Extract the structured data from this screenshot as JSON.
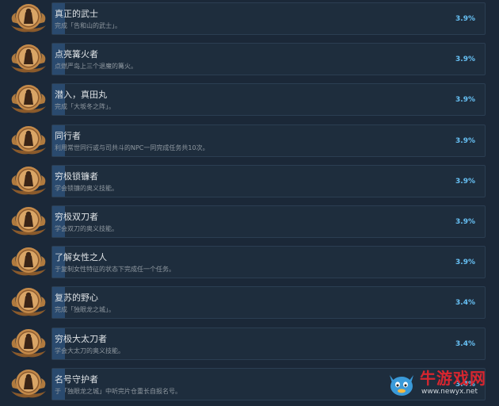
{
  "achievements": [
    {
      "title": "真正的武士",
      "desc": "完成「告和山的武士」。",
      "pct": "3.9%",
      "icon": "samurai-medal-icon"
    },
    {
      "title": "点亮篝火者",
      "desc": "点燃严岛上三个退魔的篝火。",
      "pct": "3.9%",
      "icon": "bonfire-medal-icon"
    },
    {
      "title": "潜入，真田丸",
      "desc": "完成「大坂冬之阵」。",
      "pct": "3.9%",
      "icon": "infiltrator-medal-icon"
    },
    {
      "title": "同行者",
      "desc": "利用常世同行或与司共斗的NPC一同完成任务共10次。",
      "pct": "3.9%",
      "icon": "companion-medal-icon"
    },
    {
      "title": "穷极锁镰者",
      "desc": "学会锁镰的奥义技能。",
      "pct": "3.9%",
      "icon": "kusarigama-medal-icon"
    },
    {
      "title": "穷极双刀者",
      "desc": "学会双刀的奥义技能。",
      "pct": "3.9%",
      "icon": "dual-swords-medal-icon"
    },
    {
      "title": "了解女性之人",
      "desc": "于复制女性特征的状态下完成任一个任务。",
      "pct": "3.9%",
      "icon": "woman-medal-icon"
    },
    {
      "title": "复苏的野心",
      "desc": "完成「独眼龙之城」。",
      "pct": "3.4%",
      "icon": "ambition-medal-icon"
    },
    {
      "title": "穷极大太刀者",
      "desc": "学会大太刀的奥义技能。",
      "pct": "3.4%",
      "icon": "odachi-medal-icon"
    },
    {
      "title": "名号守护者",
      "desc": "于「独眼龙之城」中听完片仓重长自报名号。",
      "pct": "3.4%",
      "icon": "guardian-medal-icon"
    }
  ],
  "watermark": {
    "title": "牛游戏网",
    "url": "www.newyx.net"
  },
  "colors": {
    "background": "#1b2838",
    "panel": "#1e2d3d",
    "accent": "#2a4a6e",
    "percent": "#67c1f5"
  }
}
